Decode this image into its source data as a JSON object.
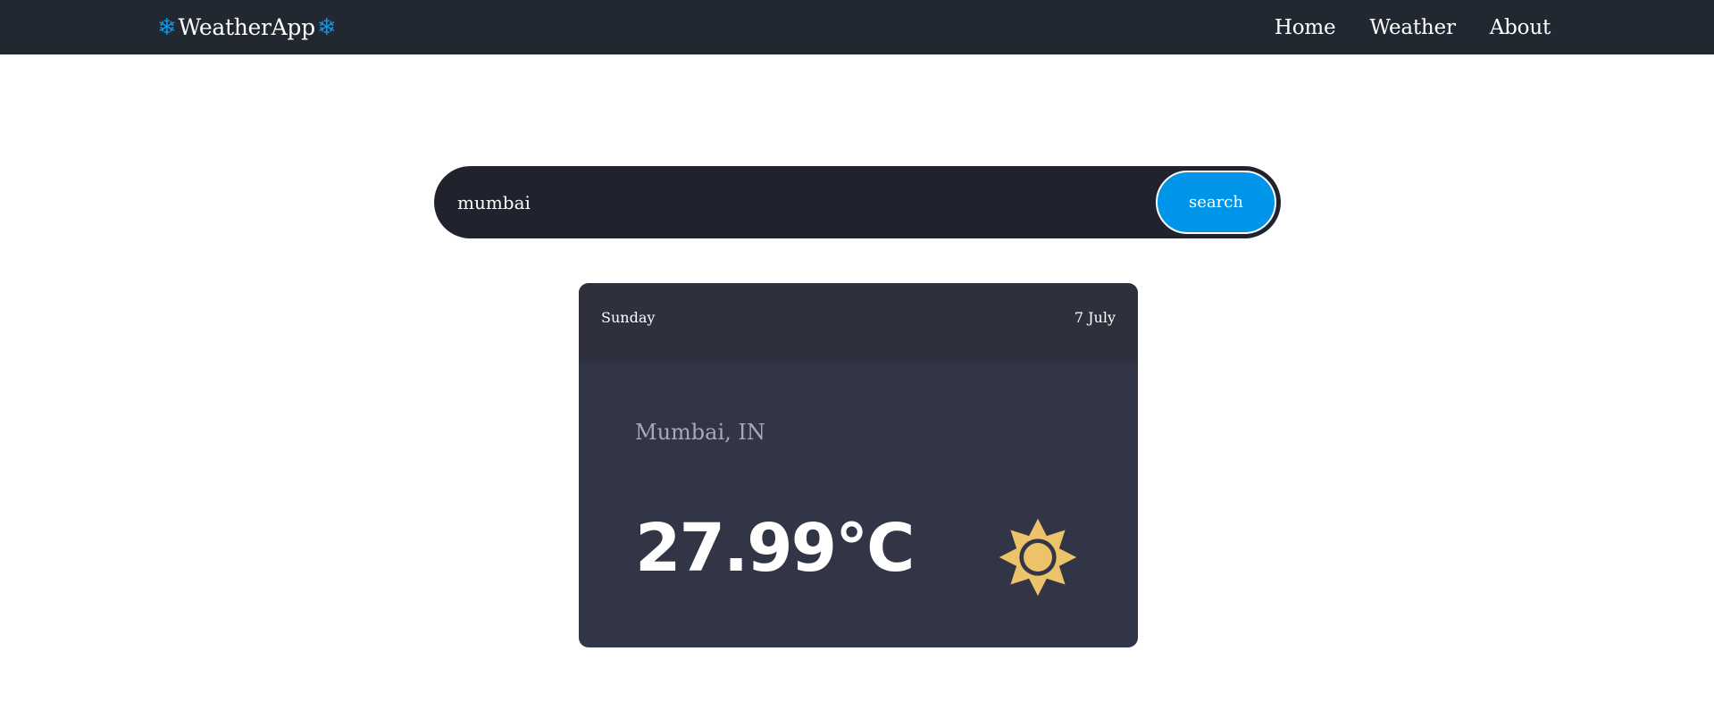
{
  "navbar": {
    "brand_icon": "snowflake-icon",
    "brand_icon_glyph": "❄",
    "brand_name": "WeatherApp",
    "links": [
      {
        "label": "Home"
      },
      {
        "label": "Weather"
      },
      {
        "label": "About"
      }
    ]
  },
  "search": {
    "value": "mumbai",
    "button_label": "search"
  },
  "card": {
    "day": "Sunday",
    "date": "7 July",
    "location": "Mumbai, IN",
    "temperature": "27.99°C",
    "icon": "sun-icon"
  },
  "colors": {
    "navbar_bg": "#212831",
    "accent": "#0095e8",
    "card_bg": "#323546",
    "card_header_bg": "#2e303d",
    "search_bg": "#20222e",
    "sun": "#ecc36a"
  }
}
